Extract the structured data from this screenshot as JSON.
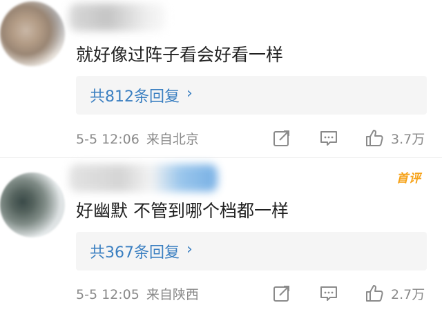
{
  "comments": [
    {
      "text": "就好像过阵子看会好看一样",
      "badge": "",
      "reply_count_label": "共812条回复",
      "reply_chevron": "›",
      "time": "5-5 12:06",
      "source": "来自北京",
      "likes": "3.7万"
    },
    {
      "text": "好幽默  不管到哪个档都一样",
      "badge": "首评",
      "reply_count_label": "共367条回复",
      "reply_chevron": "›",
      "time": "5-5 12:05",
      "source": "来自陕西",
      "likes": "2.7万"
    }
  ],
  "icons": {
    "share": "share-icon",
    "comment": "comment-icon",
    "like": "thumbs-up-icon"
  },
  "colors": {
    "link_blue": "#3a7fc1",
    "meta_gray": "#8a8a8a",
    "badge_orange": "#f6a218",
    "reply_bg": "#f5f5f5"
  }
}
